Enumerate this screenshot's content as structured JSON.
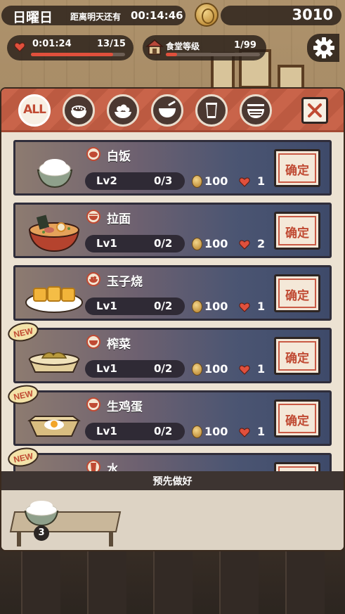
{
  "status": {
    "day": "日曜日",
    "countdown_label": "距离明天还有",
    "countdown": "00:14:46",
    "coins": "3010"
  },
  "stamina": {
    "timer": "0:01:24",
    "count": "13/15",
    "fill": 0.87
  },
  "canteen": {
    "label": "食堂等级",
    "level": "1/99",
    "fill": 0.12
  },
  "tabs": [
    {
      "label": "ALL",
      "icon": "all-icon",
      "active": true
    },
    {
      "label": "",
      "icon": "rice-bowl-icon"
    },
    {
      "label": "",
      "icon": "side-dish-icon"
    },
    {
      "label": "",
      "icon": "soup-icon"
    },
    {
      "label": "",
      "icon": "drink-icon"
    },
    {
      "label": "",
      "icon": "noodle-icon"
    }
  ],
  "dishes": [
    {
      "name": "白饭",
      "level": "Lv2",
      "progress": "0/3",
      "price": "100",
      "hearts": "1",
      "confirm": "确定",
      "is_new": false
    },
    {
      "name": "拉面",
      "level": "Lv1",
      "progress": "0/2",
      "price": "100",
      "hearts": "2",
      "confirm": "确定",
      "is_new": false
    },
    {
      "name": "玉子烧",
      "level": "Lv1",
      "progress": "0/2",
      "price": "100",
      "hearts": "1",
      "confirm": "确定",
      "is_new": false
    },
    {
      "name": "榨菜",
      "level": "Lv1",
      "progress": "0/2",
      "price": "100",
      "hearts": "1",
      "confirm": "确定",
      "is_new": true
    },
    {
      "name": "生鸡蛋",
      "level": "Lv1",
      "progress": "0/2",
      "price": "100",
      "hearts": "1",
      "confirm": "确定",
      "is_new": true
    },
    {
      "name": "水",
      "level": "",
      "progress": "",
      "price": "",
      "hearts": "",
      "confirm": "",
      "is_new": true
    }
  ],
  "new_badge": "NEW",
  "prep": {
    "title": "预先做好",
    "quantity": "3"
  },
  "colors": {
    "accent": "#c04a33",
    "heart": "#e0503c",
    "coin": "#c49440"
  }
}
